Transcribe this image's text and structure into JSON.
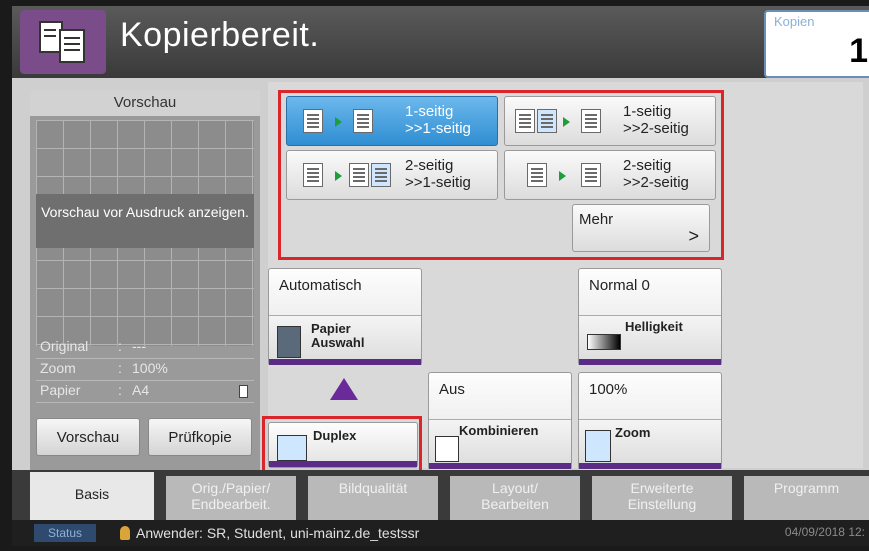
{
  "header": {
    "title": "Kopierbereit.",
    "copies_label": "Kopien",
    "copies_value": "1",
    "icon": "copy-document-icon"
  },
  "preview": {
    "heading": "Vorschau",
    "message": "Vorschau vor Ausdruck anzeigen.",
    "info": [
      {
        "key": "Original",
        "sep": ":",
        "value": "---"
      },
      {
        "key": "Zoom",
        "sep": ":",
        "value": "100%"
      },
      {
        "key": "Papier",
        "sep": ":",
        "value": "A4"
      }
    ],
    "preview_button": "Vorschau",
    "proof_button": "Prüfkopie"
  },
  "duplex_options": [
    {
      "label": "1-seitig >>1-seitig",
      "line1": "1-seitig",
      "line2": ">>1-seitig",
      "selected": true
    },
    {
      "label": "1-seitig >>2-seitig",
      "line1": "1-seitig",
      "line2": ">>2-seitig",
      "selected": false
    },
    {
      "label": "2-seitig >>1-seitig",
      "line1": "2-seitig",
      "line2": ">>1-seitig",
      "selected": false
    },
    {
      "label": "2-seitig >>2-seitig",
      "line1": "2-seitig",
      "line2": ">>2-seitig",
      "selected": false
    }
  ],
  "more_button": {
    "label": "Mehr",
    "chevron": ">"
  },
  "functions": {
    "paper": {
      "value": "Automatisch",
      "label": "Papier Auswahl",
      "line1": "Papier",
      "line2": "Auswahl"
    },
    "density": {
      "value": "Normal 0",
      "label": "Helligkeit"
    },
    "duplex": {
      "label": "Duplex"
    },
    "combine": {
      "value": "Aus",
      "label": "Kombinieren"
    },
    "zoom": {
      "value": "100%",
      "label": "Zoom"
    }
  },
  "tabs": [
    {
      "label": "Basis",
      "active": true
    },
    {
      "label": "Orig./Papier/ Endbearbeit.",
      "line1": "Orig./Papier/",
      "line2": "Endbearbeit.",
      "active": false
    },
    {
      "label": "Bildqualität",
      "active": false
    },
    {
      "label": "Layout/ Bearbeiten",
      "line1": "Layout/",
      "line2": "Bearbeiten",
      "active": false
    },
    {
      "label": "Erweiterte Einstellung",
      "line1": "Erweiterte",
      "line2": "Einstellung",
      "active": false
    },
    {
      "label": "Programm",
      "active": false
    }
  ],
  "status_bar": {
    "status_label": "Status",
    "user": "Anwender: SR, Student, uni-mainz.de_testssr",
    "datetime": "04/09/2018 12:"
  },
  "colors": {
    "accent_purple": "#5b2c86",
    "selected_blue": "#2f8ed2",
    "highlight_red": "#d8262a"
  }
}
